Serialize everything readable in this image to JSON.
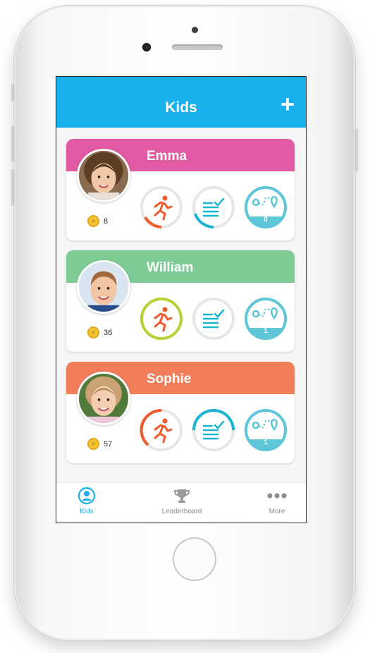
{
  "appbar": {
    "title": "Kids",
    "add_label": "+"
  },
  "colors": {
    "brand": "#18b0ec",
    "emma": "#e25aa3",
    "william": "#7ecb96",
    "sophie": "#f17d59",
    "run": "#f0592c",
    "tasks": "#1ab5d2",
    "map": "#5ec6d7"
  },
  "kids": [
    {
      "name": "Emma",
      "coins": "8",
      "map_count": "0"
    },
    {
      "name": "William",
      "coins": "36",
      "map_count": "1"
    },
    {
      "name": "Sophie",
      "coins": "57",
      "map_count": "1"
    }
  ],
  "tabs": [
    {
      "label": "Kids",
      "icon": "person-circle-icon"
    },
    {
      "label": "Leaderboard",
      "icon": "trophy-icon"
    },
    {
      "label": "More",
      "icon": "more-dots-icon"
    }
  ]
}
